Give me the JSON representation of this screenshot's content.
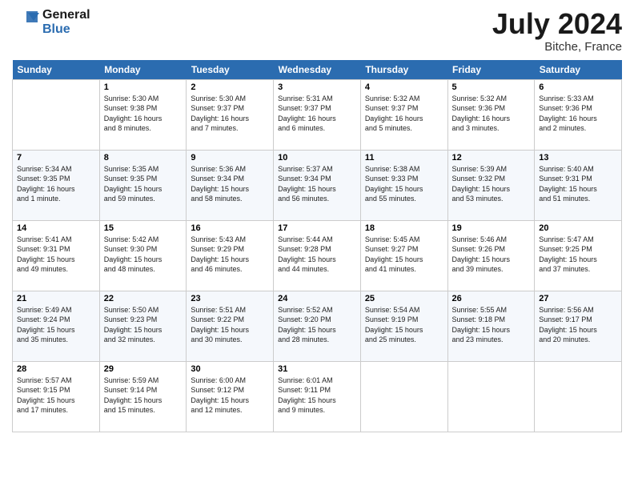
{
  "header": {
    "logo_line1": "General",
    "logo_line2": "Blue",
    "month_title": "July 2024",
    "location": "Bitche, France"
  },
  "days_of_week": [
    "Sunday",
    "Monday",
    "Tuesday",
    "Wednesday",
    "Thursday",
    "Friday",
    "Saturday"
  ],
  "weeks": [
    [
      {
        "day": "",
        "info": ""
      },
      {
        "day": "1",
        "info": "Sunrise: 5:30 AM\nSunset: 9:38 PM\nDaylight: 16 hours\nand 8 minutes."
      },
      {
        "day": "2",
        "info": "Sunrise: 5:30 AM\nSunset: 9:37 PM\nDaylight: 16 hours\nand 7 minutes."
      },
      {
        "day": "3",
        "info": "Sunrise: 5:31 AM\nSunset: 9:37 PM\nDaylight: 16 hours\nand 6 minutes."
      },
      {
        "day": "4",
        "info": "Sunrise: 5:32 AM\nSunset: 9:37 PM\nDaylight: 16 hours\nand 5 minutes."
      },
      {
        "day": "5",
        "info": "Sunrise: 5:32 AM\nSunset: 9:36 PM\nDaylight: 16 hours\nand 3 minutes."
      },
      {
        "day": "6",
        "info": "Sunrise: 5:33 AM\nSunset: 9:36 PM\nDaylight: 16 hours\nand 2 minutes."
      }
    ],
    [
      {
        "day": "7",
        "info": "Sunrise: 5:34 AM\nSunset: 9:35 PM\nDaylight: 16 hours\nand 1 minute."
      },
      {
        "day": "8",
        "info": "Sunrise: 5:35 AM\nSunset: 9:35 PM\nDaylight: 15 hours\nand 59 minutes."
      },
      {
        "day": "9",
        "info": "Sunrise: 5:36 AM\nSunset: 9:34 PM\nDaylight: 15 hours\nand 58 minutes."
      },
      {
        "day": "10",
        "info": "Sunrise: 5:37 AM\nSunset: 9:34 PM\nDaylight: 15 hours\nand 56 minutes."
      },
      {
        "day": "11",
        "info": "Sunrise: 5:38 AM\nSunset: 9:33 PM\nDaylight: 15 hours\nand 55 minutes."
      },
      {
        "day": "12",
        "info": "Sunrise: 5:39 AM\nSunset: 9:32 PM\nDaylight: 15 hours\nand 53 minutes."
      },
      {
        "day": "13",
        "info": "Sunrise: 5:40 AM\nSunset: 9:31 PM\nDaylight: 15 hours\nand 51 minutes."
      }
    ],
    [
      {
        "day": "14",
        "info": "Sunrise: 5:41 AM\nSunset: 9:31 PM\nDaylight: 15 hours\nand 49 minutes."
      },
      {
        "day": "15",
        "info": "Sunrise: 5:42 AM\nSunset: 9:30 PM\nDaylight: 15 hours\nand 48 minutes."
      },
      {
        "day": "16",
        "info": "Sunrise: 5:43 AM\nSunset: 9:29 PM\nDaylight: 15 hours\nand 46 minutes."
      },
      {
        "day": "17",
        "info": "Sunrise: 5:44 AM\nSunset: 9:28 PM\nDaylight: 15 hours\nand 44 minutes."
      },
      {
        "day": "18",
        "info": "Sunrise: 5:45 AM\nSunset: 9:27 PM\nDaylight: 15 hours\nand 41 minutes."
      },
      {
        "day": "19",
        "info": "Sunrise: 5:46 AM\nSunset: 9:26 PM\nDaylight: 15 hours\nand 39 minutes."
      },
      {
        "day": "20",
        "info": "Sunrise: 5:47 AM\nSunset: 9:25 PM\nDaylight: 15 hours\nand 37 minutes."
      }
    ],
    [
      {
        "day": "21",
        "info": "Sunrise: 5:49 AM\nSunset: 9:24 PM\nDaylight: 15 hours\nand 35 minutes."
      },
      {
        "day": "22",
        "info": "Sunrise: 5:50 AM\nSunset: 9:23 PM\nDaylight: 15 hours\nand 32 minutes."
      },
      {
        "day": "23",
        "info": "Sunrise: 5:51 AM\nSunset: 9:22 PM\nDaylight: 15 hours\nand 30 minutes."
      },
      {
        "day": "24",
        "info": "Sunrise: 5:52 AM\nSunset: 9:20 PM\nDaylight: 15 hours\nand 28 minutes."
      },
      {
        "day": "25",
        "info": "Sunrise: 5:54 AM\nSunset: 9:19 PM\nDaylight: 15 hours\nand 25 minutes."
      },
      {
        "day": "26",
        "info": "Sunrise: 5:55 AM\nSunset: 9:18 PM\nDaylight: 15 hours\nand 23 minutes."
      },
      {
        "day": "27",
        "info": "Sunrise: 5:56 AM\nSunset: 9:17 PM\nDaylight: 15 hours\nand 20 minutes."
      }
    ],
    [
      {
        "day": "28",
        "info": "Sunrise: 5:57 AM\nSunset: 9:15 PM\nDaylight: 15 hours\nand 17 minutes."
      },
      {
        "day": "29",
        "info": "Sunrise: 5:59 AM\nSunset: 9:14 PM\nDaylight: 15 hours\nand 15 minutes."
      },
      {
        "day": "30",
        "info": "Sunrise: 6:00 AM\nSunset: 9:12 PM\nDaylight: 15 hours\nand 12 minutes."
      },
      {
        "day": "31",
        "info": "Sunrise: 6:01 AM\nSunset: 9:11 PM\nDaylight: 15 hours\nand 9 minutes."
      },
      {
        "day": "",
        "info": ""
      },
      {
        "day": "",
        "info": ""
      },
      {
        "day": "",
        "info": ""
      }
    ]
  ]
}
